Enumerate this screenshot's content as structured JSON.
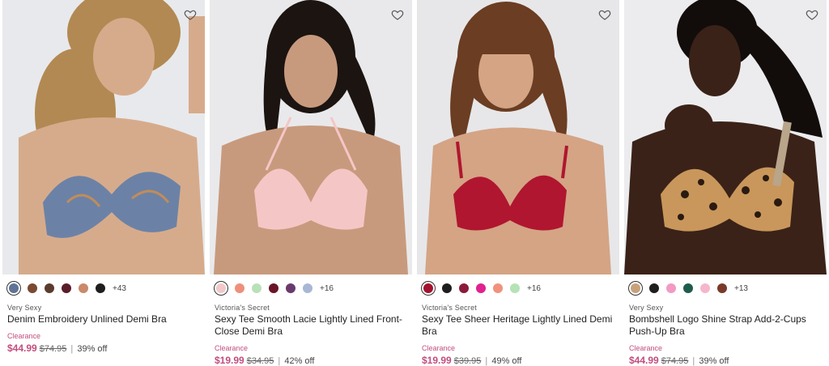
{
  "products": [
    {
      "brand": "Very Sexy",
      "name": "Denim Embroidery Unlined Demi Bra",
      "status": "Clearance",
      "price": "$44.99",
      "original_price": "$74.95",
      "discount": "39% off",
      "more_colors": "+43",
      "favorite_icon": "heart-outline-icon",
      "swatches": [
        "#5f7396",
        "#7a4a32",
        "#5a3c2e",
        "#5b1c2a",
        "#c9896a",
        "#1e1e1e"
      ],
      "image": {
        "bg": "#e8e9ec",
        "skin": "#d6ab8c",
        "hair": "#b28952",
        "garment": "#6b82a6"
      }
    },
    {
      "brand": "Victoria's Secret",
      "name": "Sexy Tee Smooth Lacie Lightly Lined Front-Close Demi Bra",
      "status": "Clearance",
      "price": "$19.99",
      "original_price": "$34.95",
      "discount": "42% off",
      "more_colors": "+16",
      "favorite_icon": "heart-outline-icon",
      "swatches": [
        "#f2c9c9",
        "#ee8f7c",
        "#b9e0b9",
        "#6b1428",
        "#6a3a6e",
        "#a8b8d4"
      ],
      "image": {
        "bg": "#e9e9eb",
        "skin": "#c89a7d",
        "hair": "#1b1411",
        "garment": "#f5c6c6"
      }
    },
    {
      "brand": "Victoria's Secret",
      "name": "Sexy Tee Sheer Heritage Lightly Lined Demi Bra",
      "status": "Clearance",
      "price": "$19.99",
      "original_price": "$39.95",
      "discount": "49% off",
      "more_colors": "+16",
      "favorite_icon": "heart-outline-icon",
      "swatches": [
        "#a3122e",
        "#1e1e1e",
        "#8c1a3c",
        "#e0218f",
        "#f0927c",
        "#b6e2b6"
      ],
      "image": {
        "bg": "#e7e7e9",
        "skin": "#d4a485",
        "hair": "#6b3d22",
        "garment": "#b0162f"
      }
    },
    {
      "brand": "Very Sexy",
      "name": "Bombshell Logo Shine Strap Add-2-Cups Push-Up Bra",
      "status": "Clearance",
      "price": "$44.99",
      "original_price": "$74.95",
      "discount": "39% off",
      "more_colors": "+13",
      "favorite_icon": "heart-outline-icon",
      "swatches": [
        "#c8a27a",
        "#1e1e1e",
        "#f29ac2",
        "#1f5c4c",
        "#f5b6cc",
        "#7a3a2a"
      ],
      "image": {
        "bg": "#ececee",
        "skin": "#3a2218",
        "hair": "#120d0b",
        "garment": "#c9975b"
      }
    }
  ]
}
